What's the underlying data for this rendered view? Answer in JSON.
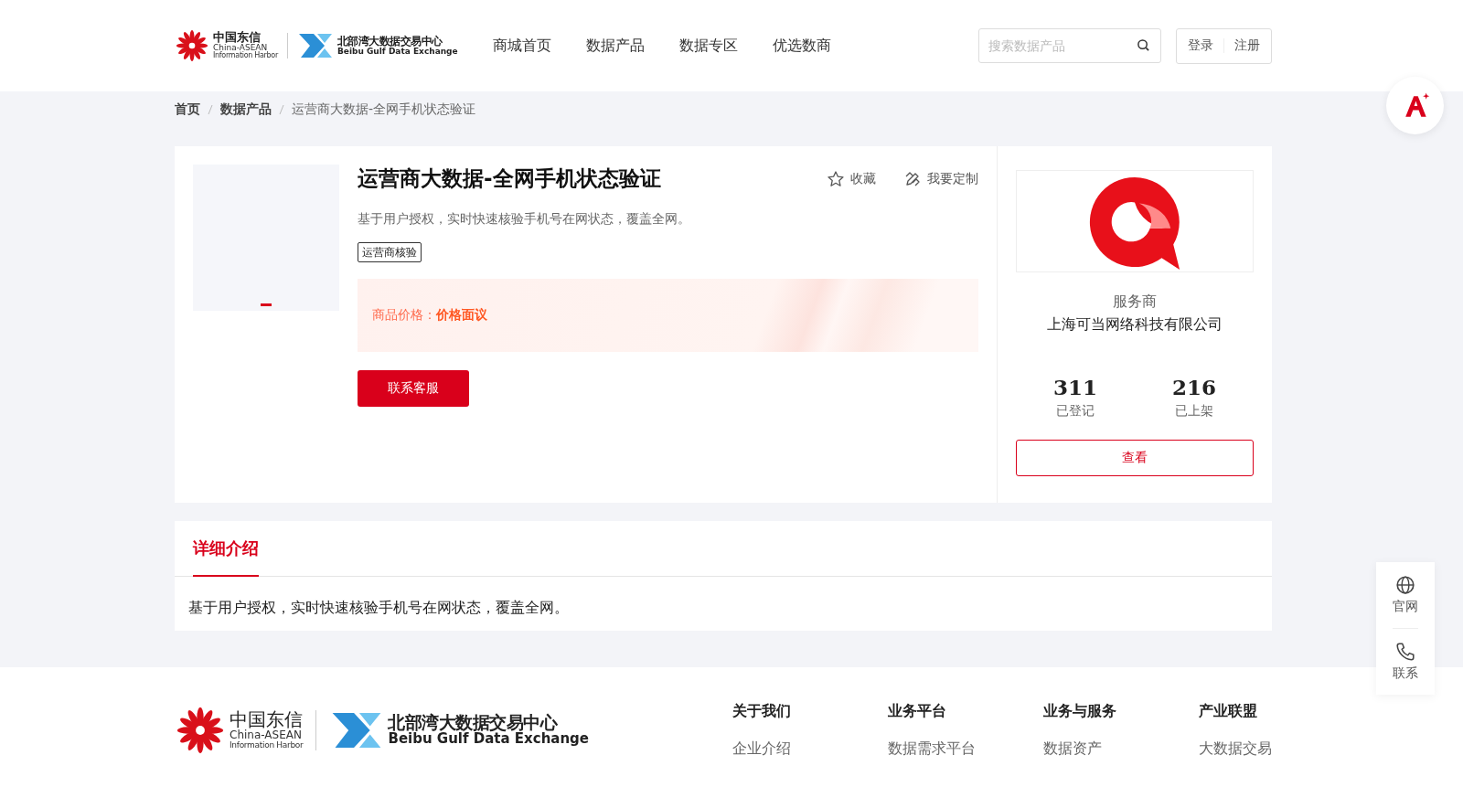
{
  "header": {
    "logo": {
      "cn": "中国东信",
      "en": "China-ASEAN",
      "en_sub": "Information Harbor",
      "exchange_cn": "北部湾大数据交易中心",
      "exchange_en": "Beibu Gulf Data Exchange"
    },
    "nav": [
      "商城首页",
      "数据产品",
      "数据专区",
      "优选数商"
    ],
    "search": {
      "placeholder": "搜索数据产品"
    },
    "auth": [
      "登录",
      "注册"
    ]
  },
  "breadcrumb": [
    "首页",
    "数据产品",
    "运营商大数据-全网手机状态验证"
  ],
  "product": {
    "title": "运营商大数据-全网手机状态验证",
    "actions": [
      {
        "label": "收藏",
        "kind": "favorite"
      },
      {
        "label": "我要定制",
        "kind": "customize"
      }
    ],
    "description": "基于用户授权，实时快速核验手机号在网状态，覆盖全网。",
    "tags": [
      "运营商核验"
    ],
    "price_label": "商品价格：",
    "price": "价格面议",
    "contact_button": "联系客服"
  },
  "provider": {
    "label": "服务商",
    "name": "上海可当网络科技有限公司",
    "stats": [
      {
        "value": "311",
        "label": "已登记"
      },
      {
        "value": "216",
        "label": "已上架"
      }
    ],
    "view_button": "查看"
  },
  "detail": {
    "tabs": [
      {
        "label": "详细介绍",
        "selected": true
      }
    ],
    "text": "基于用户授权，实时快速核验手机号在网状态，覆盖全网。"
  },
  "footer": {
    "logo": {
      "cn": "中国东信",
      "en": "China-ASEAN",
      "en_sub": "Information Harbor",
      "exchange_cn": "北部湾大数据交易中心",
      "exchange_en": "Beibu Gulf Data Exchange"
    },
    "columns": [
      {
        "heading": "关于我们",
        "links": [
          "企业介绍"
        ]
      },
      {
        "heading": "业务平台",
        "links": [
          "数据需求平台"
        ]
      },
      {
        "heading": "业务与服务",
        "links": [
          "数据资产"
        ]
      },
      {
        "heading": "产业联盟",
        "links": [
          "大数据交易"
        ]
      }
    ]
  },
  "floating": [
    {
      "label": "官网",
      "kind": "web"
    },
    {
      "label": "联系",
      "kind": "phone"
    }
  ]
}
